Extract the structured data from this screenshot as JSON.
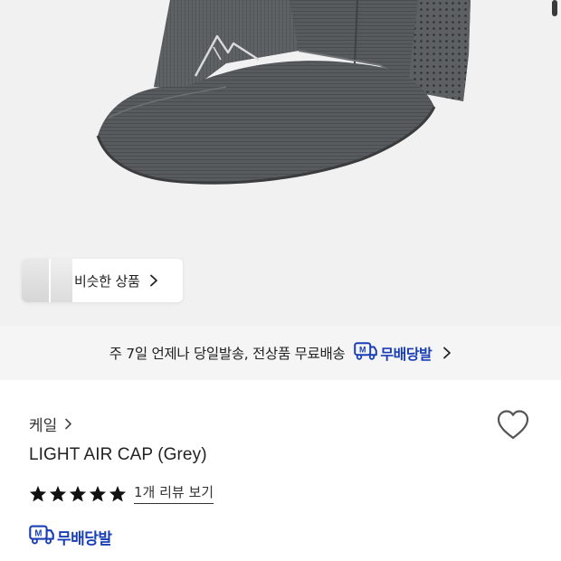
{
  "product_image": {
    "alt": "LIGHT AIR CAP (Grey)"
  },
  "similar_products": {
    "label": "비슷한 상품"
  },
  "delivery_banner": {
    "text": "주 7일 언제나 당일발송, 전상품 무료배송",
    "badge_icon_letter": "M",
    "badge_label": "무배당발"
  },
  "product": {
    "brand": "케일",
    "name": "LIGHT AIR CAP (Grey)",
    "rating_stars": 5,
    "review_link_label": "1개 리뷰 보기",
    "badge_icon_letter": "M",
    "badge_label": "무배당발"
  },
  "colors": {
    "accent_blue": "#1a3fb5",
    "star": "#111111",
    "banner_bg": "#f5f5f5",
    "image_bg": "#f1f1f1"
  },
  "icons": {
    "wishlist": "heart-outline-icon",
    "chevron": "chevron-right-icon",
    "star": "star-filled-icon",
    "delivery": "delivery-truck-icon"
  }
}
